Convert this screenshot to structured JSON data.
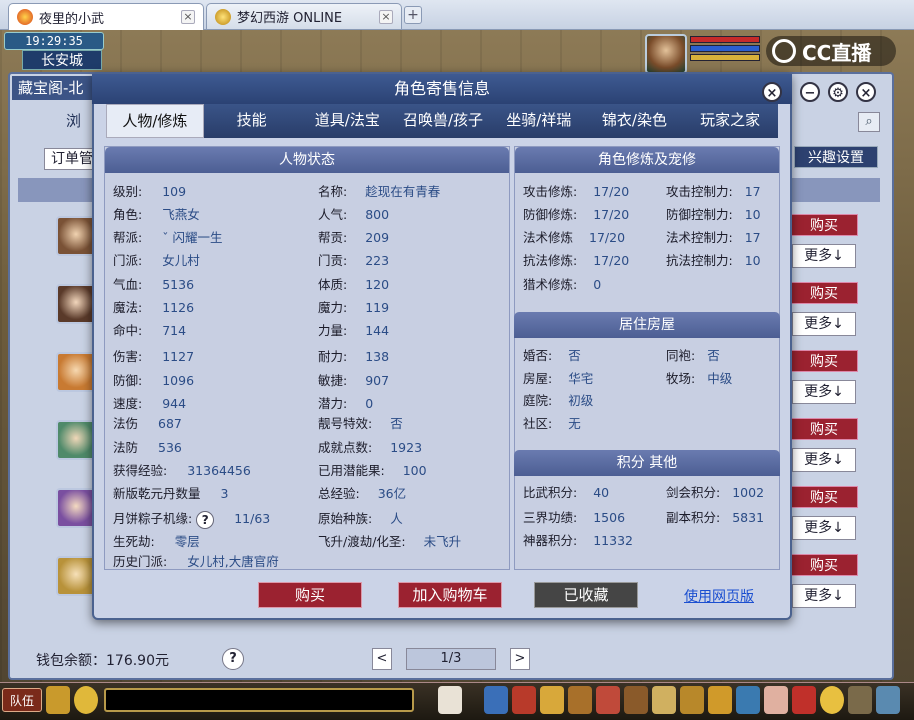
{
  "browser": {
    "tabs": [
      {
        "title": "夜里的小武",
        "close": "×"
      },
      {
        "title": "梦幻西游 ONLINE",
        "close": "×"
      }
    ],
    "newtab": "+"
  },
  "hud": {
    "time": "19:29:35",
    "city": "长安城",
    "stream_logo": "CC直播"
  },
  "market": {
    "title": "藏宝阁-北",
    "browse": "浏",
    "order": "订单管",
    "interest_settings": "兴趣设置",
    "buy_label": "购买",
    "more_label": "更多↓",
    "wallet": "钱包余额：176.90元",
    "help": "?",
    "page": "1/3",
    "prev": "<",
    "next": ">"
  },
  "dialog": {
    "title": "角色寄售信息",
    "tabs": [
      "人物/修炼",
      "技能",
      "道具/法宝",
      "召唤兽/孩子",
      "坐骑/祥瑞",
      "锦衣/染色",
      "玩家之家"
    ],
    "left_header": "人物状态",
    "left_col1": [
      [
        "级别:",
        "109"
      ],
      [
        "角色:",
        "飞燕女"
      ],
      [
        "帮派:",
        "ˇ 闪耀一生"
      ],
      [
        "门派:",
        "女儿村"
      ],
      [
        "气血:",
        "5136"
      ],
      [
        "魔法:",
        "1126"
      ],
      [
        "命中:",
        "714"
      ],
      [
        "伤害:",
        "1127"
      ],
      [
        "防御:",
        "1096"
      ],
      [
        "速度:",
        "944"
      ],
      [
        "法伤",
        "687"
      ],
      [
        "法防",
        "536"
      ],
      [
        "获得经验:",
        "31364456"
      ],
      [
        "新版乾元丹数量",
        "3"
      ],
      [
        "月饼粽子机缘:",
        "11/63"
      ],
      [
        "生死劫:",
        "零层"
      ],
      [
        "历史门派:",
        "女儿村,大唐官府"
      ]
    ],
    "left_col2": [
      [
        "名称:",
        "趁现在有青春"
      ],
      [
        "人气:",
        "800"
      ],
      [
        "帮贡:",
        "209"
      ],
      [
        "门贡:",
        "223"
      ],
      [
        "体质:",
        "120"
      ],
      [
        "魔力:",
        "119"
      ],
      [
        "力量:",
        "144"
      ],
      [
        "耐力:",
        "138"
      ],
      [
        "敏捷:",
        "907"
      ],
      [
        "潜力:",
        "0"
      ],
      [
        "靓号特效:",
        "否"
      ],
      [
        "成就点数:",
        "1923"
      ],
      [
        "已用潜能果:",
        "100"
      ],
      [
        "总经验:",
        "36亿"
      ],
      [
        "原始种族:",
        "人"
      ],
      [
        "飞升/渡劫/化圣:",
        "未飞升"
      ]
    ],
    "cult_header": "角色修炼及宠修",
    "cult": [
      [
        "攻击修炼:",
        "17/20",
        "攻击控制力:",
        "17"
      ],
      [
        "防御修炼:",
        "17/20",
        "防御控制力:",
        "10"
      ],
      [
        "法术修炼",
        "17/20",
        "法术控制力:",
        "17"
      ],
      [
        "抗法修炼:",
        "17/20",
        "抗法控制力:",
        "10"
      ],
      [
        "猎术修炼:",
        "0",
        "",
        ""
      ]
    ],
    "house_header": "居住房屋",
    "house": [
      [
        "婚否:",
        "否",
        "同袍:",
        "否"
      ],
      [
        "房屋:",
        "华宅",
        "牧场:",
        "中级"
      ],
      [
        "庭院:",
        "初级",
        "",
        ""
      ],
      [
        "社区:",
        "无",
        "",
        ""
      ]
    ],
    "score_header": "积分 其他",
    "score": [
      [
        "比武积分:",
        "40",
        "剑会积分:",
        "1002"
      ],
      [
        "三界功绩:",
        "1506",
        "副本积分:",
        "5831"
      ],
      [
        "神器积分:",
        "11332",
        "",
        ""
      ]
    ],
    "buy": "购买",
    "add_cart": "加入购物车",
    "favorited": "已收藏",
    "web_version": "使用网页版",
    "close": "×",
    "minimize": "−",
    "settings": "⚙",
    "close2": "×"
  },
  "bottom": {
    "team": "队伍"
  }
}
